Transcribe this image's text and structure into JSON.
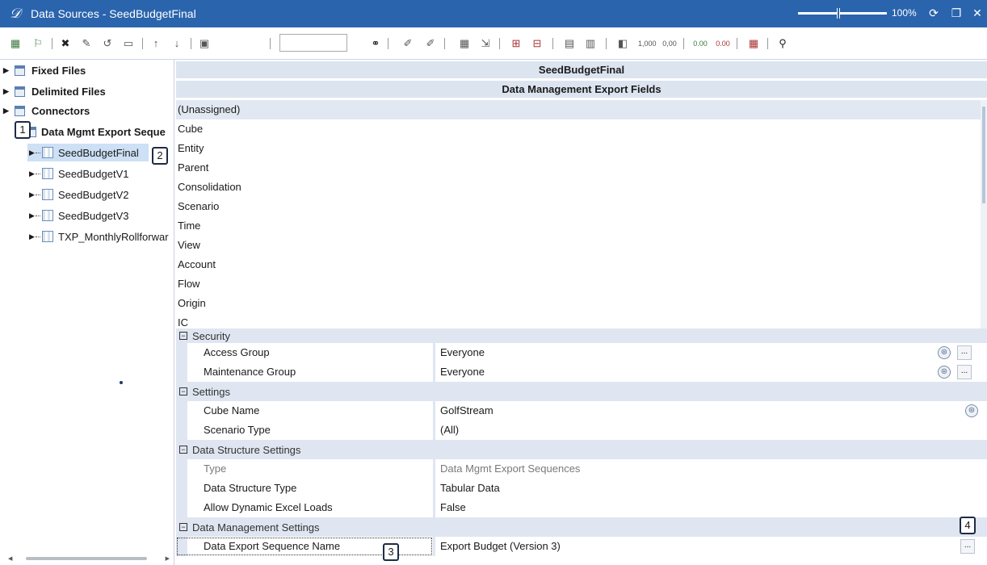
{
  "window": {
    "title": "Data Sources - SeedBudgetFinal",
    "zoom": "100%"
  },
  "tree": {
    "groups": [
      {
        "label": "Fixed Files"
      },
      {
        "label": "Delimited Files"
      },
      {
        "label": "Connectors"
      },
      {
        "label": "Data Mgmt Export Seque"
      }
    ],
    "children": [
      {
        "label": "SeedBudgetFinal",
        "selected": true
      },
      {
        "label": "SeedBudgetV1"
      },
      {
        "label": "SeedBudgetV2"
      },
      {
        "label": "SeedBudgetV3"
      },
      {
        "label": "TXP_MonthlyRollforwar"
      }
    ]
  },
  "main": {
    "header_title": "SeedBudgetFinal",
    "section_title": "Data Management Export Fields",
    "fields": [
      "(Unassigned)",
      "Cube",
      "Entity",
      "Parent",
      "Consolidation",
      "Scenario",
      "Time",
      "View",
      "Account",
      "Flow",
      "Origin",
      "IC"
    ]
  },
  "properties": {
    "security": {
      "group": "Security",
      "access_group_label": "Access Group",
      "access_group_value": "Everyone",
      "maintenance_group_label": "Maintenance Group",
      "maintenance_group_value": "Everyone"
    },
    "settings": {
      "group": "Settings",
      "cube_name_label": "Cube Name",
      "cube_name_value": "GolfStream",
      "scenario_type_label": "Scenario Type",
      "scenario_type_value": "(All)"
    },
    "structure": {
      "group": "Data Structure Settings",
      "type_label": "Type",
      "type_value": "Data Mgmt Export Sequences",
      "structure_type_label": "Data Structure Type",
      "structure_type_value": "Tabular Data",
      "dynamic_label": "Allow Dynamic Excel Loads",
      "dynamic_value": "False"
    },
    "dm": {
      "group": "Data Management Settings",
      "seq_name_label": "Data Export Sequence Name",
      "seq_name_value": "Export Budget (Version 3)"
    },
    "ellipsis": "..."
  },
  "callouts": [
    "1",
    "2",
    "3",
    "4"
  ]
}
